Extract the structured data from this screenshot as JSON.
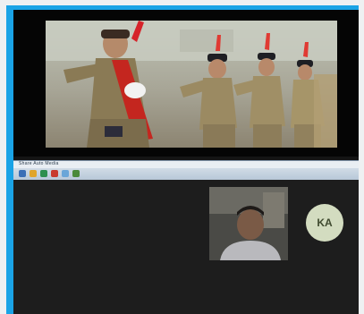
{
  "taskbar": {
    "text": "Share Auto Media"
  },
  "participant": {
    "initials": "KA",
    "avatar_color": "#d3dcc0"
  },
  "colors": {
    "frame": "#1aa3e6",
    "stage": "#050505",
    "call_bg": "#1d1d1d"
  }
}
